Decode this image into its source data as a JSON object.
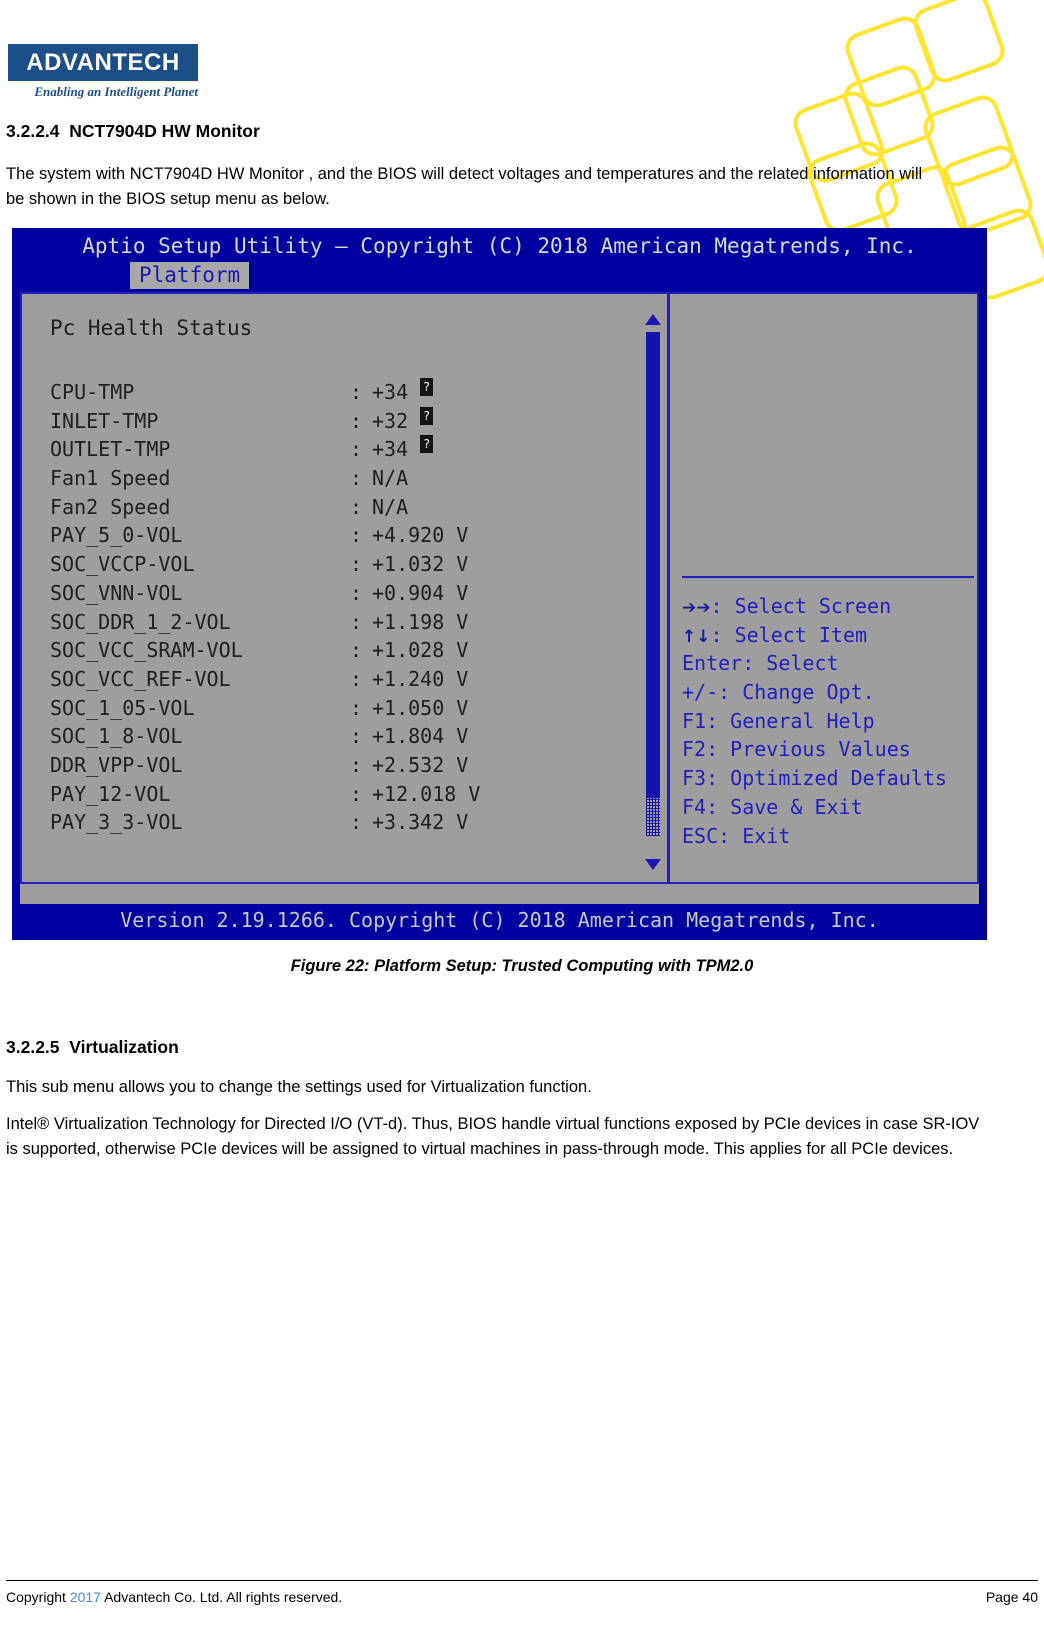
{
  "brand": {
    "logo_text": "ADVANTECH",
    "tagline": "Enabling an Intelligent Planet",
    "logo_color": "#1c4e88"
  },
  "document": {
    "section_heading_1": "3.2.2.4  NCT7904D HW Monitor",
    "paragraph_1": "The system with NCT7904D HW Monitor , and the BIOS will  detect voltages and temperatures and the related information will be shown in the BIOS setup menu as below.",
    "figure_caption": "Figure 22: Platform Setup: Trusted Computing with TPM2.0",
    "section_heading_2": "3.2.2.5  Virtualization",
    "paragraph_2": "This sub menu allows you to change the settings used for Virtualization function.",
    "paragraph_3": "Intel® Virtualization Technology for Directed I/O (VT-d). Thus, BIOS handle virtual functions exposed by PCIe devices in case SR-IOV is supported, otherwise PCIe devices will be assigned to virtual machines in pass-through mode. This applies for all PCIe devices."
  },
  "footer": {
    "copyright_prefix": "Copyright ",
    "year": "2017",
    "copyright_suffix": "  Advantech Co. Ltd. All rights reserved.",
    "page": "Page 40",
    "year_color": "#3f8bd8"
  },
  "bios": {
    "title": "Aptio Setup Utility – Copyright (C) 2018 American Megatrends, Inc.",
    "active_tab": "Platform",
    "pane_title": "Pc Health Status",
    "version_bar": "Version 2.19.1266. Copyright (C) 2018 American Megatrends, Inc.",
    "colors": {
      "screen_blue": "#0000a0",
      "panel_gray": "#9e9e9e",
      "border_blue": "#2020c0",
      "help_text_blue": "#2222bb"
    },
    "rows": [
      {
        "label": "CPU-TMP",
        "separator": ":",
        "value": "+34 ",
        "unit_glyph": "tofu"
      },
      {
        "label": "INLET-TMP",
        "separator": ":",
        "value": "+32 ",
        "unit_glyph": "tofu"
      },
      {
        "label": "OUTLET-TMP",
        "separator": ":",
        "value": "+34 ",
        "unit_glyph": "tofu"
      },
      {
        "label": "Fan1 Speed",
        "separator": ":",
        "value": "N/A",
        "unit_glyph": ""
      },
      {
        "label": "Fan2 Speed",
        "separator": ":",
        "value": "N/A",
        "unit_glyph": ""
      },
      {
        "label": "PAY_5_0-VOL",
        "separator": ":",
        "value": "+4.920 V",
        "unit_glyph": ""
      },
      {
        "label": "SOC_VCCP-VOL",
        "separator": ":",
        "value": "+1.032 V",
        "unit_glyph": ""
      },
      {
        "label": "SOC_VNN-VOL",
        "separator": ":",
        "value": "+0.904 V",
        "unit_glyph": ""
      },
      {
        "label": "SOC_DDR_1_2-VOL",
        "separator": ":",
        "value": "+1.198 V",
        "unit_glyph": ""
      },
      {
        "label": "SOC_VCC_SRAM-VOL",
        "separator": ":",
        "value": "+1.028 V",
        "unit_glyph": ""
      },
      {
        "label": "SOC_VCC_REF-VOL",
        "separator": ":",
        "value": "+1.240 V",
        "unit_glyph": ""
      },
      {
        "label": "SOC_1_05-VOL",
        "separator": ":",
        "value": "+1.050 V",
        "unit_glyph": ""
      },
      {
        "label": "SOC_1_8-VOL",
        "separator": ":",
        "value": "+1.804 V",
        "unit_glyph": ""
      },
      {
        "label": "DDR_VPP-VOL",
        "separator": ":",
        "value": "+2.532 V",
        "unit_glyph": ""
      },
      {
        "label": "PAY_12-VOL",
        "separator": ":",
        "value": "+12.018 V",
        "unit_glyph": ""
      },
      {
        "label": "PAY_3_3-VOL",
        "separator": ":",
        "value": "+3.342 V",
        "unit_glyph": ""
      }
    ],
    "help_keys": [
      {
        "glyph": "➔➔",
        "text": ": Select Screen"
      },
      {
        "glyph": "↑↓",
        "text": ": Select Item"
      },
      {
        "glyph": "",
        "text": "Enter: Select"
      },
      {
        "glyph": "",
        "text": "+/-: Change Opt."
      },
      {
        "glyph": "",
        "text": "F1: General Help"
      },
      {
        "glyph": "",
        "text": "F2: Previous Values"
      },
      {
        "glyph": "",
        "text": "F3: Optimized Defaults"
      },
      {
        "glyph": "",
        "text": "F4: Save & Exit"
      },
      {
        "glyph": "",
        "text": "ESC: Exit"
      }
    ],
    "scrollbar": {
      "up_arrow": "▲",
      "down_arrow": "▼"
    }
  }
}
